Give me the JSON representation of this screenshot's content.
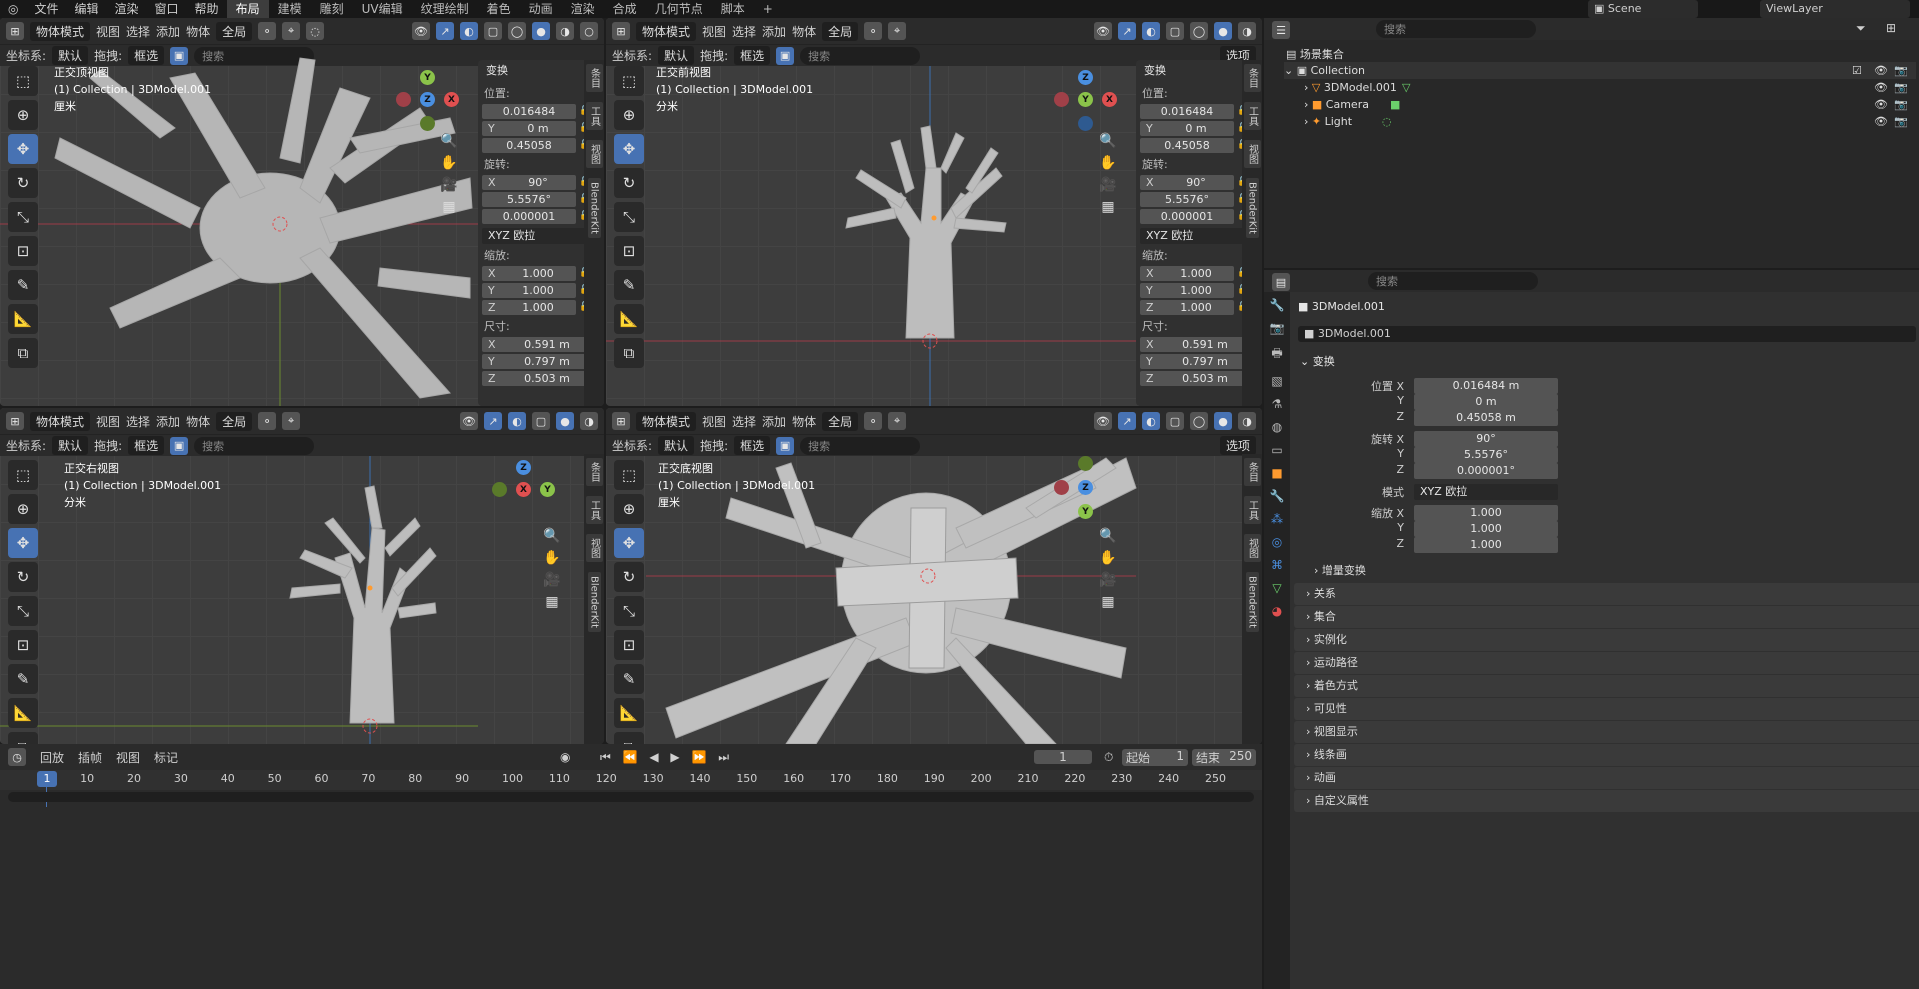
{
  "topmenu": [
    "文件",
    "编辑",
    "渲染",
    "窗口",
    "帮助"
  ],
  "workspaces": [
    "布局",
    "建模",
    "雕刻",
    "UV编辑",
    "纹理绘制",
    "着色",
    "动画",
    "渲染",
    "合成",
    "几何节点",
    "脚本",
    "+"
  ],
  "active_workspace": "布局",
  "scene": "Scene",
  "viewlayer": "ViewLayer",
  "search_ph": "搜索",
  "vp_header": {
    "mode": "物体模式",
    "view": "视图",
    "select": "选择",
    "add": "添加",
    "object": "物体",
    "orient": "全局",
    "coord_label": "坐标系:",
    "coord_val": "默认",
    "drag_label": "拖拽:",
    "drag_val": "框选",
    "options": "选项"
  },
  "viewports": [
    {
      "name": "正交顶视图",
      "collection": "(1) Collection | 3DModel.001",
      "unit": "厘米"
    },
    {
      "name": "正交前视图",
      "collection": "(1) Collection | 3DModel.001",
      "unit": "分米"
    },
    {
      "name": "正交右视图",
      "collection": "(1) Collection | 3DModel.001",
      "unit": "分米"
    },
    {
      "name": "正交底视图",
      "collection": "(1) Collection | 3DModel.001",
      "unit": "厘米"
    }
  ],
  "npanel": {
    "title": "变换",
    "loc": "位置:",
    "rot": "旋转:",
    "scale": "缩放:",
    "dim": "尺寸:",
    "lx": "0.016484",
    "ly": "0 m",
    "lz": "0.45058",
    "rx": "90°",
    "ry": "5.5576°",
    "rz": "0.000001",
    "euler": "XYZ 欧拉",
    "sx": "1.000",
    "sy": "1.000",
    "sz": "1.000",
    "dx": "0.591 m",
    "dy": "0.797 m",
    "dz": "0.503 m",
    "X": "X",
    "Y": "Y",
    "Z": "Z"
  },
  "side_tabs": [
    "条目",
    "工具",
    "视图",
    "BlenderKit"
  ],
  "outliner": {
    "scene_collection": "场景集合",
    "collection": "Collection",
    "items": [
      "3DModel.001",
      "Camera",
      "Light"
    ]
  },
  "properties": {
    "object": "3DModel.001",
    "data": "3DModel.001",
    "transform": "变换",
    "loc_label": "位置 X",
    "rot_label": "旋转 X",
    "mode_label": "模式",
    "scale_label": "缩放 X",
    "Y": "Y",
    "Z": "Z",
    "loc": [
      "0.016484 m",
      "0 m",
      "0.45058 m"
    ],
    "rot": [
      "90°",
      "5.5576°",
      "0.000001°"
    ],
    "mode": "XYZ 欧拉",
    "scale": [
      "1.000",
      "1.000",
      "1.000"
    ],
    "delta": "增量变换",
    "sections": [
      "关系",
      "集合",
      "实例化",
      "运动路径",
      "着色方式",
      "可见性",
      "视图显示",
      "线条画",
      "动画",
      "自定义属性"
    ]
  },
  "timeline": {
    "menu": [
      "回放",
      "插帧",
      "视图",
      "标记"
    ],
    "frame": "1",
    "start_label": "起始",
    "start": "1",
    "end_label": "结束",
    "end": "250",
    "current": "1",
    "ticks": [
      "10",
      "20",
      "30",
      "40",
      "50",
      "60",
      "70",
      "80",
      "90",
      "100",
      "110",
      "120",
      "130",
      "140",
      "150",
      "160",
      "170",
      "180",
      "190",
      "200",
      "210",
      "220",
      "230",
      "240",
      "250"
    ]
  }
}
